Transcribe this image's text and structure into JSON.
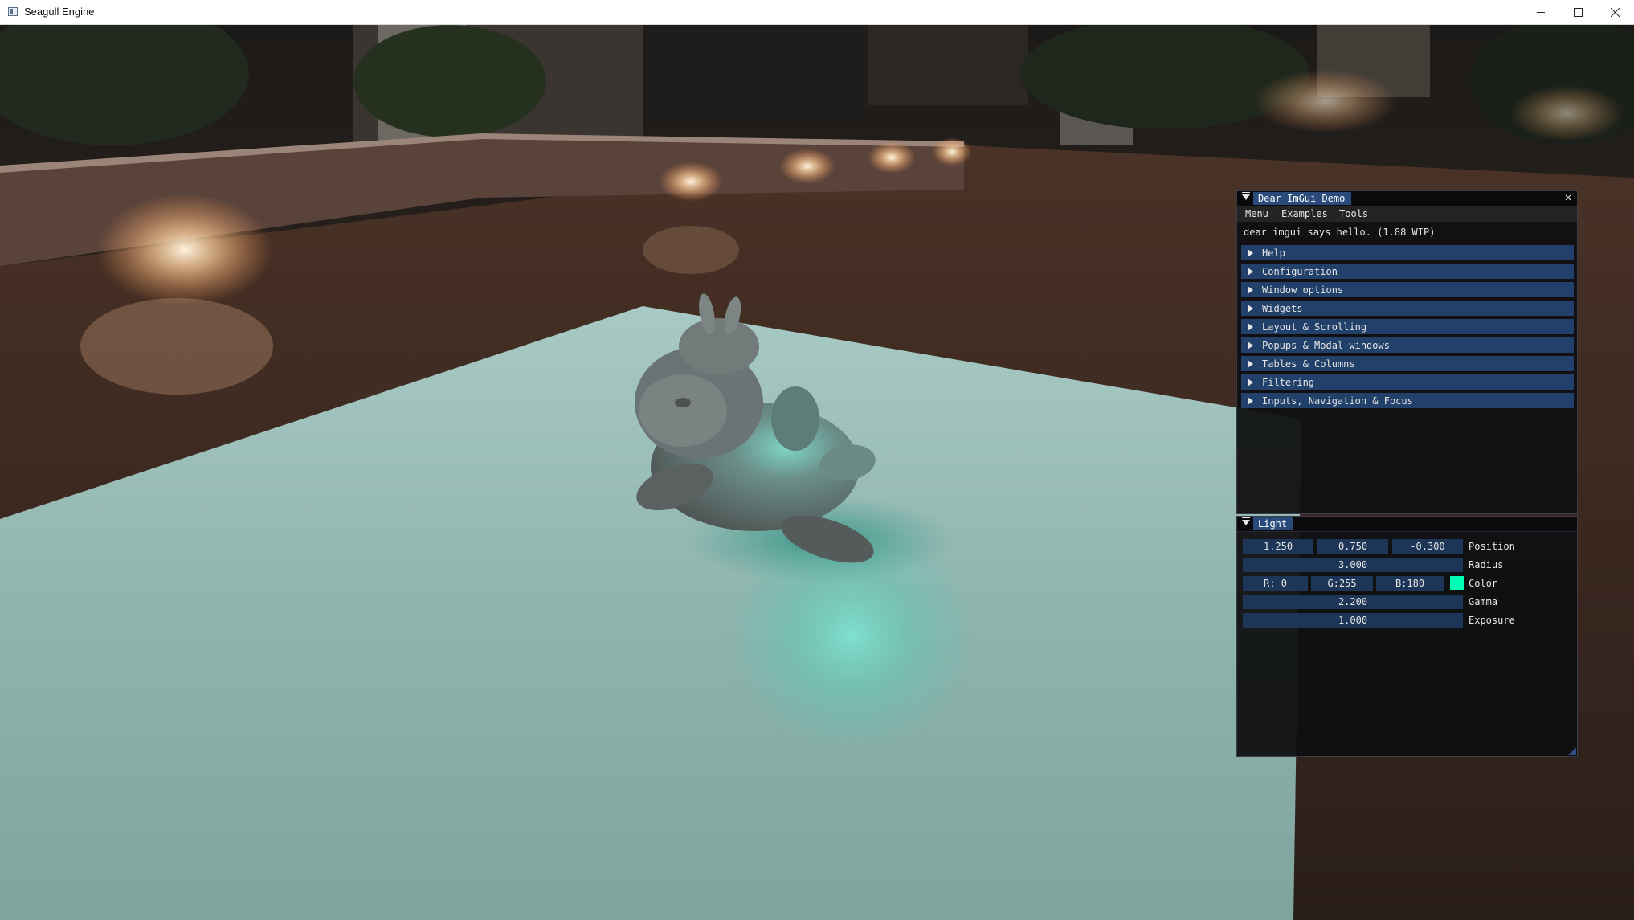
{
  "window": {
    "title": "Seagull Engine"
  },
  "demo_window": {
    "title": "Dear ImGui Demo",
    "menu": [
      "Menu",
      "Examples",
      "Tools"
    ],
    "hello_text": "dear imgui says hello. (1.88 WIP)",
    "headers": [
      "Help",
      "Configuration",
      "Window options",
      "Widgets",
      "Layout & Scrolling",
      "Popups & Modal windows",
      "Tables & Columns",
      "Filtering",
      "Inputs, Navigation & Focus"
    ]
  },
  "light_window": {
    "title": "Light",
    "position": {
      "x": "1.250",
      "y": "0.750",
      "z": "-0.300",
      "label": "Position"
    },
    "radius": {
      "value": "3.000",
      "label": "Radius"
    },
    "color": {
      "r": "R:  0",
      "g": "G:255",
      "b": "B:180",
      "label": "Color",
      "swatch": "#00ffb4"
    },
    "gamma": {
      "value": "2.200",
      "label": "Gamma"
    },
    "exposure": {
      "value": "1.000",
      "label": "Exposure"
    }
  },
  "colors": {
    "imgui_header": "#21406a",
    "imgui_title_active": "#294a7a",
    "plane": "#8fb3ad",
    "light_glow": "#00ffb4"
  },
  "icons": [
    "app-icon",
    "minimize-icon",
    "maximize-icon",
    "close-icon",
    "collapse-arrow-icon",
    "tree-arrow-icon"
  ]
}
